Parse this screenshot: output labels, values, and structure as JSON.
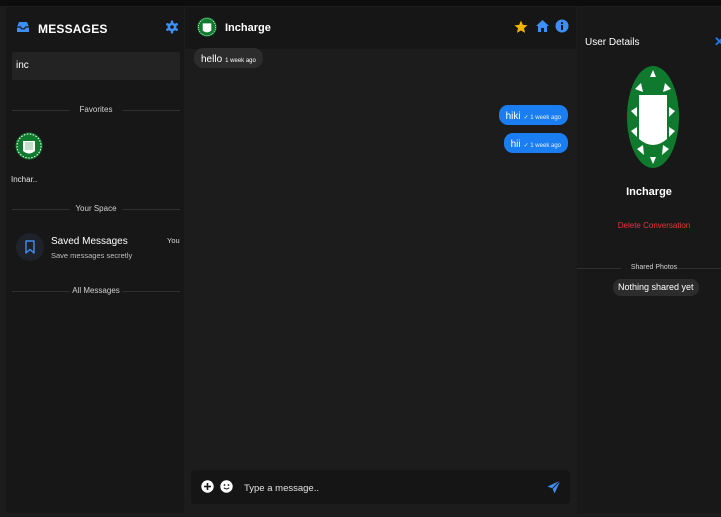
{
  "colors": {
    "accent": "#1a7ef2",
    "star": "#f5b400",
    "danger": "#e53935",
    "avatar_green": "#0f7a2e",
    "background": "#1c1c1c"
  },
  "sidebar": {
    "title": "MESSAGES",
    "icons": {
      "title": "inbox-icon",
      "settings": "gear-icon"
    },
    "search": {
      "value": "inc",
      "placeholder": ""
    },
    "sections": {
      "favorites": "Favorites",
      "your_space": "Your Space",
      "all_messages": "All Messages"
    },
    "favorites": [
      {
        "name": "Inchar..",
        "avatar": "hospital-logo-avatar"
      }
    ],
    "saved": {
      "title": "Saved Messages",
      "subtitle": "Save messages secretly",
      "badge": "You",
      "icon": "bookmark-icon"
    }
  },
  "chat": {
    "contact": {
      "name": "Incharge",
      "avatar": "hospital-logo-avatar"
    },
    "header_icons": [
      "star-icon",
      "home-icon",
      "info-icon"
    ],
    "messages": [
      {
        "direction": "in",
        "text": "hello",
        "time": "1 week ago"
      },
      {
        "direction": "out",
        "text": "hiki",
        "time": "✓ 1 week ago"
      },
      {
        "direction": "out",
        "text": "hii",
        "time": "✓ 1 week ago"
      }
    ],
    "composer": {
      "placeholder": "Type a message..",
      "icons": [
        "plus-circle-icon",
        "emoji-icon",
        "send-icon"
      ]
    }
  },
  "details": {
    "title": "User Details",
    "close_icon": "close-icon",
    "name": "Incharge",
    "delete_label": "Delete Conversation",
    "shared_photos_label": "Shared Photos",
    "empty_label": "Nothing shared yet"
  }
}
